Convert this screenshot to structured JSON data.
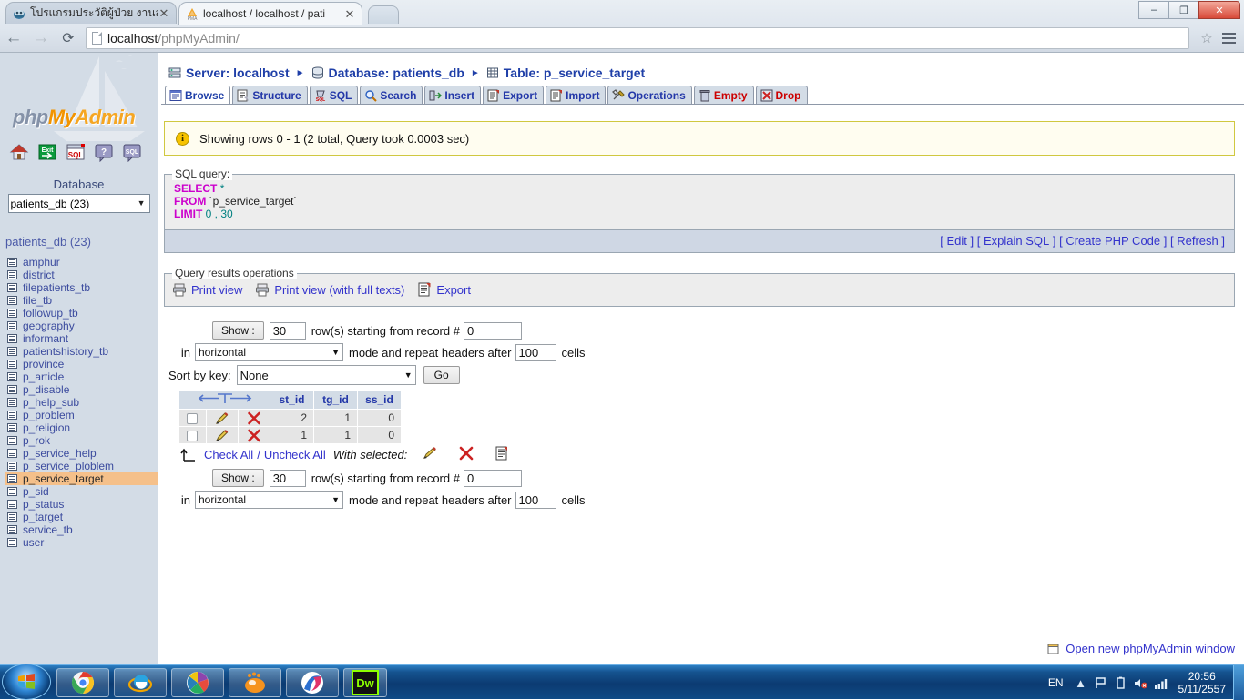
{
  "browser": {
    "tabs": [
      {
        "title": "โปรแกรมประวัติผู้ป่วย งานสัง",
        "favicon": "app-icon",
        "active": false
      },
      {
        "title": "localhost / localhost / pati",
        "favicon": "pma-icon",
        "active": true
      }
    ],
    "url_host": "localhost",
    "url_path": "/phpMyAdmin/",
    "back_icon": "back-arrow-icon",
    "forward_icon": "forward-arrow-icon",
    "reload_icon": "reload-icon",
    "star_icon": "bookmark-star-icon",
    "menu_icon": "chrome-menu-icon",
    "window_buttons": {
      "minimize": "–",
      "restore": "❐",
      "close": "✕"
    }
  },
  "sidebar": {
    "logo": {
      "php": "php",
      "my": "My",
      "admin": "Admin"
    },
    "nav_icons": [
      "home-icon",
      "exit-icon",
      "sql-window-icon",
      "help-icon",
      "sql-query-icon"
    ],
    "database_label": "Database",
    "database_select_value": "patients_db (23)",
    "database_heading": "patients_db (23)",
    "tables": [
      {
        "name": "amphur",
        "selected": false
      },
      {
        "name": "district",
        "selected": false
      },
      {
        "name": "filepatients_tb",
        "selected": false
      },
      {
        "name": "file_tb",
        "selected": false
      },
      {
        "name": "followup_tb",
        "selected": false
      },
      {
        "name": "geography",
        "selected": false
      },
      {
        "name": "informant",
        "selected": false
      },
      {
        "name": "patientshistory_tb",
        "selected": false
      },
      {
        "name": "province",
        "selected": false
      },
      {
        "name": "p_article",
        "selected": false
      },
      {
        "name": "p_disable",
        "selected": false
      },
      {
        "name": "p_help_sub",
        "selected": false
      },
      {
        "name": "p_problem",
        "selected": false
      },
      {
        "name": "p_religion",
        "selected": false
      },
      {
        "name": "p_rok",
        "selected": false
      },
      {
        "name": "p_service_help",
        "selected": false
      },
      {
        "name": "p_service_ploblem",
        "selected": false
      },
      {
        "name": "p_service_target",
        "selected": true
      },
      {
        "name": "p_sid",
        "selected": false
      },
      {
        "name": "p_status",
        "selected": false
      },
      {
        "name": "p_target",
        "selected": false
      },
      {
        "name": "service_tb",
        "selected": false
      },
      {
        "name": "user",
        "selected": false
      }
    ]
  },
  "breadcrumb": [
    {
      "label": "Server: localhost",
      "icon": "server-icon"
    },
    {
      "label": "Database: patients_db",
      "icon": "database-icon"
    },
    {
      "label": "Table: p_service_target",
      "icon": "table-icon"
    }
  ],
  "tabs": [
    {
      "label": "Browse",
      "icon": "browse-icon",
      "active": true,
      "warn": false
    },
    {
      "label": "Structure",
      "icon": "structure-icon",
      "active": false,
      "warn": false
    },
    {
      "label": "SQL",
      "icon": "sql-icon",
      "active": false,
      "warn": false
    },
    {
      "label": "Search",
      "icon": "search-icon",
      "active": false,
      "warn": false
    },
    {
      "label": "Insert",
      "icon": "insert-icon",
      "active": false,
      "warn": false
    },
    {
      "label": "Export",
      "icon": "export-icon",
      "active": false,
      "warn": false
    },
    {
      "label": "Import",
      "icon": "import-icon",
      "active": false,
      "warn": false
    },
    {
      "label": "Operations",
      "icon": "operations-icon",
      "active": false,
      "warn": false
    },
    {
      "label": "Empty",
      "icon": "empty-icon",
      "active": false,
      "warn": true
    },
    {
      "label": "Drop",
      "icon": "drop-icon",
      "active": false,
      "warn": true
    }
  ],
  "notice": {
    "icon": "info-icon",
    "text": "Showing rows 0 - 1 (2 total, Query took 0.0003 sec)"
  },
  "sql_query": {
    "legend": "SQL query:",
    "line1_kw": "SELECT",
    "line1_val": "*",
    "line2_kw": "FROM",
    "line2_val": "`p_service_target`",
    "line3_kw": "LIMIT",
    "line3_val": "0 , 30",
    "actions": [
      "Edit",
      "Explain SQL",
      "Create PHP Code",
      "Refresh"
    ]
  },
  "query_results_operations": {
    "legend": "Query results operations",
    "links": [
      {
        "label": "Print view",
        "icon": "printer-icon"
      },
      {
        "label": "Print view (with full texts)",
        "icon": "printer-icon"
      },
      {
        "label": "Export",
        "icon": "export-icon"
      }
    ]
  },
  "query_form": {
    "show_button": "Show :",
    "rows_value": "30",
    "rows_label": "row(s) starting from record #",
    "record_value": "0",
    "in_label": "in",
    "mode_value": "horizontal",
    "mode_label": "mode and repeat headers after",
    "headers_value": "100",
    "cells_label": "cells",
    "sort_label": "Sort by key:",
    "sort_value": "None",
    "go_button": "Go"
  },
  "results_table": {
    "sort_icon": "sort-arrows-icon",
    "columns": [
      "st_id",
      "tg_id",
      "ss_id"
    ],
    "rows": [
      {
        "checkbox": false,
        "edit_icon": "edit-pencil-icon",
        "delete_icon": "delete-x-icon",
        "values": [
          "2",
          "1",
          "0"
        ]
      },
      {
        "checkbox": false,
        "edit_icon": "edit-pencil-icon",
        "delete_icon": "delete-x-icon",
        "values": [
          "1",
          "1",
          "0"
        ]
      }
    ],
    "check_all": "Check All",
    "separator": "/",
    "uncheck_all": "Uncheck All",
    "with_selected": "With selected:",
    "bulk_icons": [
      "edit-pencil-icon",
      "delete-x-icon",
      "export-icon"
    ],
    "arrow_icon": "up-arrow-icon"
  },
  "footer": {
    "open_new_window": "Open new phpMyAdmin window",
    "icon": "new-window-icon"
  },
  "taskbar": {
    "start_icon": "windows-start-icon",
    "apps": [
      {
        "name": "chrome-taskbar-icon"
      },
      {
        "name": "internet-explorer-taskbar-icon"
      },
      {
        "name": "picasa-taskbar-icon"
      },
      {
        "name": "gom-player-taskbar-icon"
      },
      {
        "name": "silverlight-taskbar-icon"
      },
      {
        "name": "dreamweaver-taskbar-icon"
      }
    ],
    "language": "EN",
    "tray_icons": [
      "show-hidden-icons",
      "flag-action-center-icon",
      "battery-icon",
      "volume-muted-icon",
      "network-signal-icon"
    ],
    "time": "20:56",
    "date": "5/11/2557"
  }
}
